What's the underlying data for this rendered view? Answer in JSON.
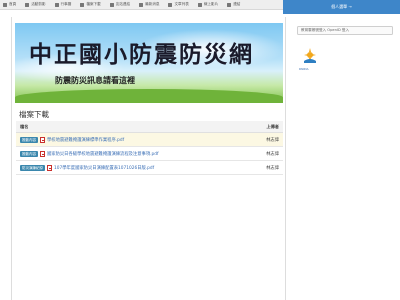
{
  "nav": {
    "items": [
      {
        "label": "首頁",
        "icon": "home-icon"
      },
      {
        "label": "活動剪影",
        "icon": "image-icon"
      },
      {
        "label": "行事曆",
        "icon": "calendar-icon"
      },
      {
        "label": "檔案下載",
        "icon": "download-icon"
      },
      {
        "label": "友站連結",
        "icon": "link-icon"
      },
      {
        "label": "最新消息",
        "icon": "news-icon"
      },
      {
        "label": "文章列表",
        "icon": "list-icon"
      },
      {
        "label": "線上影片",
        "icon": "video-icon"
      },
      {
        "label": "連結",
        "icon": "link-icon"
      }
    ],
    "login_label": "個人選單 →"
  },
  "banner": {
    "title": "中正國小防震防災網",
    "subtitle": "防震防災訊息請看這裡"
  },
  "page": {
    "title": "檔案下載"
  },
  "table": {
    "headers": {
      "name": "檔名",
      "uploader": "上傳者"
    },
    "rows": [
      {
        "tag": "推動內容",
        "name": "學校地震避難掩護演練標準作業程序.pdf",
        "uploader": "林志偉",
        "highlight": true
      },
      {
        "tag": "推動內容",
        "name": "國家防災日各級學校地震避難掩護演練流程及注意事項.pdf",
        "uploader": "林志偉",
        "highlight": false
      },
      {
        "tag": "防災演練紀錄",
        "name": "107學年度國家防災日演練配置表1071026日版.pdf",
        "uploader": "林志偉",
        "highlight": false
      }
    ]
  },
  "sidebar": {
    "openid_label": "教育雲帳號登入 OpenID 登入",
    "logo_text": "PANDA"
  },
  "colors": {
    "accent": "#3e86c9",
    "tag": "#3a87ad",
    "pdf": "#c9302c",
    "link": "#3b6fb6",
    "highlight_row": "#fcf8e3"
  }
}
